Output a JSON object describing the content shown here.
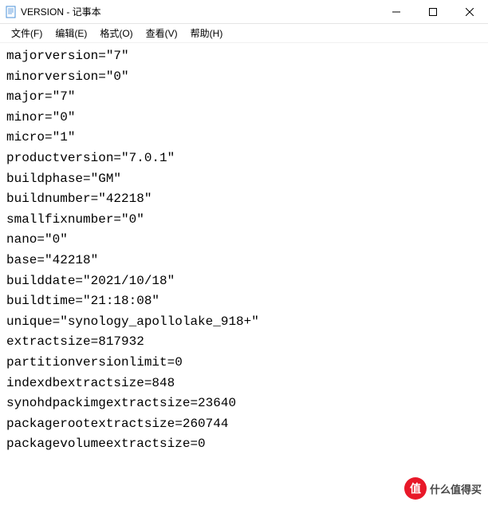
{
  "window": {
    "title": "VERSION - 记事本"
  },
  "menu": {
    "file": "文件(F)",
    "edit": "编辑(E)",
    "format": "格式(O)",
    "view": "查看(V)",
    "help": "帮助(H)"
  },
  "content_lines": [
    "majorversion=\"7\"",
    "minorversion=\"0\"",
    "major=\"7\"",
    "minor=\"0\"",
    "micro=\"1\"",
    "productversion=\"7.0.1\"",
    "buildphase=\"GM\"",
    "buildnumber=\"42218\"",
    "smallfixnumber=\"0\"",
    "nano=\"0\"",
    "base=\"42218\"",
    "builddate=\"2021/10/18\"",
    "buildtime=\"21:18:08\"",
    "unique=\"synology_apollolake_918+\"",
    "extractsize=817932",
    "partitionversionlimit=0",
    "indexdbextractsize=848",
    "synohdpackimgextractsize=23640",
    "packagerootextractsize=260744",
    "packagevolumeextractsize=0"
  ],
  "watermark": {
    "icon": "值",
    "text": "什么值得买"
  }
}
